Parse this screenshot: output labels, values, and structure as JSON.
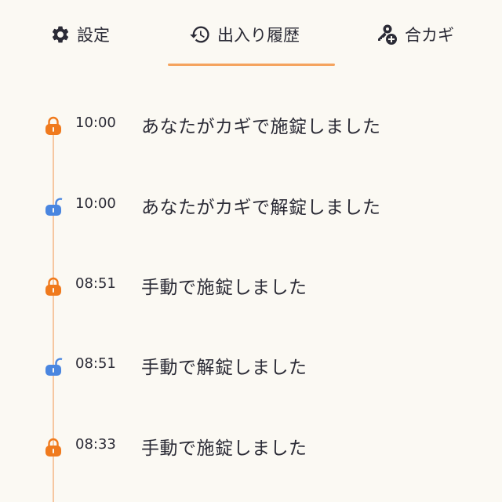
{
  "tabs": [
    {
      "label": "設定",
      "icon": "gear-icon",
      "active": false
    },
    {
      "label": "出入り履歴",
      "icon": "history-icon",
      "active": true
    },
    {
      "label": "合カギ",
      "icon": "add-key-icon",
      "active": false
    }
  ],
  "colors": {
    "background": "#fbf9f3",
    "accent": "#f5a35e",
    "locked": "#f07a1d",
    "unlocked": "#4a86e0",
    "timeline": "#f6c7a0"
  },
  "history": [
    {
      "time": "10:00",
      "message": "あなたがカギで施錠しました",
      "status": "locked",
      "icon": "locked-padlock-icon"
    },
    {
      "time": "10:00",
      "message": "あなたがカギで解錠しました",
      "status": "unlocked",
      "icon": "unlocked-padlock-icon"
    },
    {
      "time": "08:51",
      "message": "手動で施錠しました",
      "status": "locked",
      "icon": "locked-padlock-icon"
    },
    {
      "time": "08:51",
      "message": "手動で解錠しました",
      "status": "unlocked",
      "icon": "unlocked-padlock-icon"
    },
    {
      "time": "08:33",
      "message": "手動で施錠しました",
      "status": "locked",
      "icon": "locked-padlock-icon"
    }
  ]
}
